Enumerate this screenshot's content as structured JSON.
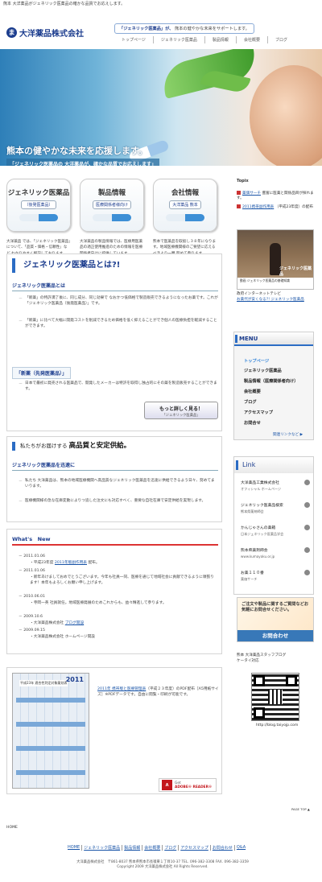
{
  "top_strip": "熊本 大洋薬品がジェネリック医薬品の確かな品質でお応えします。",
  "brand": {
    "mark": "ま",
    "name": "大洋薬品株式会社"
  },
  "tagline": {
    "quote": "「ジェネリック医薬品」が、",
    "rest": "熊本の健やかな未来をサポートします。"
  },
  "gnav": [
    "トップページ",
    "ジェネリック医薬品",
    "製品情報",
    "会社概要",
    "ブログ"
  ],
  "hero": {
    "headline": "熊本の健やかな未来を応援します。",
    "sub": "「ジェネリック医薬品の 大洋薬品が、確かな品質でお応えします」"
  },
  "cards": [
    {
      "title": "ジェネリック医薬品",
      "sub": "（後発医薬品）",
      "desc": "大洋薬品 では、「ジェネリック医薬品」について、「品質・価格・信頼性」など わかりやすく解説しております。"
    },
    {
      "title": "製品情報",
      "sub": "医療関係者様向け",
      "desc": "大洋薬品の製品情報では、医療用医薬品の適正使用推進のための情報を医療関係者向けに提供しています。"
    },
    {
      "title": "会社情報",
      "sub": "大洋薬品 熊本",
      "desc": "熊本で医薬品を取扱し３８年になります。地域医療機関様のご要望に応えるべきより一層 努めて参ります。"
    }
  ],
  "generic": {
    "title": "ジェネリック医薬品とは?!",
    "h1": "ジェネリック医薬品とは",
    "p1": "「新薬」の特許満了後に、同じ成分、同じ効果で なおかつ低価格で製造販売できるようになったお薬です。これが「ジェネリック医薬品（後発医薬品）」です。",
    "p2": "「新薬」に比べて大幅に開発コストを削減できるため価格を低く抑えることができ個人の医療負担を軽減することができます。",
    "h2": "「新薬（先発医薬品）」",
    "p3": "日本で最初に発売される医薬品で、開発したメーカーは特許を取得し独占的にその薬を製造販売することができます。",
    "more": "もっと詳しく見る！",
    "more_sub": "「ジェネリック医薬品」"
  },
  "quality": {
    "title_pre": "私たちがお届けする",
    "title_main": "高品質と安定供給。",
    "h": "ジェネリック医薬品を迅速に",
    "p1": "私たち 大洋薬品は、熊本の地域医療機関へ高品質なジェネリック医薬品を迅速に供給できるよう日々、努めてまいります。",
    "p2": "医療機関様の急な在庫変動によりつ追した注文にも対応すべく、重要な自社在庫で安定供給を実現します。"
  },
  "whats_new": {
    "title": "What's　New",
    "items": [
      {
        "date": "2011.01.06",
        "pre": "平成23年度",
        "link": "2011年版副作用表",
        "post": "配布。"
      },
      {
        "date": "2011.01.06",
        "pre": "新年あけましておめでとうございます。今年も社員一同、医療を通じて地域社会に貢献できるように頑張ります！本年もよろしくお願い申し上げます。",
        "link": "",
        "post": ""
      },
      {
        "date": "2010.06.01",
        "pre": "寺岡一英 社員就任。地域医療発展のためこれからも、益々精進して参ります。",
        "link": "",
        "post": ""
      },
      {
        "date": "2009.10.6",
        "pre": "大洋薬品株式会社",
        "link": "ブログ開設",
        "post": ""
      },
      {
        "date": "2009.09.15",
        "pre": "大洋薬品株式会社 ホームページ開設",
        "link": "",
        "post": ""
      }
    ]
  },
  "download": {
    "cal_year": "2011",
    "cal_title": "平成23年 適合性判定対象薬効表",
    "link": "2011年 携帯版と医療管理表",
    "text": "（平成２３年度）のPDF配布［A5用紙サイズ］※PDFデータです。自由に閲覧・印刷が可能です。",
    "adobe_get": "Get",
    "adobe_name": "ADOBE® READER®"
  },
  "topix": {
    "title": "Topix",
    "items": [
      {
        "link": "薬価サーチ",
        "text": "豊富に医薬と関係品目が探れます。"
      },
      {
        "link": "2011携帯副作用表",
        "text": "（平成23年度）の配布"
      }
    ],
    "video_bar": "動画 ジェネリック医薬品の基礎知識",
    "video_overlay": "ジェネリック医薬品",
    "caption1": "政府インターネットテレビ",
    "caption2": "お薬代が安くなる?! ジェネリック医薬品"
  },
  "menu": {
    "title": "MENU",
    "items": [
      "トップページ",
      "ジェネリック医薬品",
      "製品情報（医療関係者向け）",
      "会社概要",
      "ブログ",
      "アクセスマップ",
      "お問合せ"
    ],
    "related": "関連リンクなど"
  },
  "links": {
    "title": "Link",
    "items": [
      {
        "name": "大洋薬品工業株式会社",
        "sub": "オフィシャル ホームページ"
      },
      {
        "name": "ジェネリック医薬品検索",
        "sub": "熊本県薬剤師会"
      },
      {
        "name": "かんじゃさんの薬箱",
        "sub": "日本ジェネリック医薬品学会"
      },
      {
        "name": "熊本県薬剤師会",
        "sub": "www.kumayaku.or.jp"
      },
      {
        "name": "お薬１１０番",
        "sub": "薬価サーチ"
      }
    ]
  },
  "contact_banner": {
    "line1": "ご注文や製品に関するご質問などお気軽にお問合せください。",
    "button": "お問合わせ"
  },
  "staff": {
    "line1": "熊本 大洋薬品スタッフブログ",
    "line2": "ケータイ対応",
    "url": "http://blog.taiyojp.com"
  },
  "pagetop": "PAGE TOP ▲",
  "breadcrumb": "HOME",
  "footer": {
    "links": [
      "HOME",
      "ジェネリック医薬品",
      "製品情報",
      "会社概要",
      "ブログ",
      "アクセスマップ",
      "お問合わせ",
      "Q&A"
    ],
    "address": "大洋薬品株式会社　〒861-8037 熊本県熊本市長嶺東１丁目10-37 TEL. 096-382-3308 FAX. 096-382-3359",
    "copyright": "Copyright 2009 大洋薬品株式会社 All Rights Reserved."
  }
}
